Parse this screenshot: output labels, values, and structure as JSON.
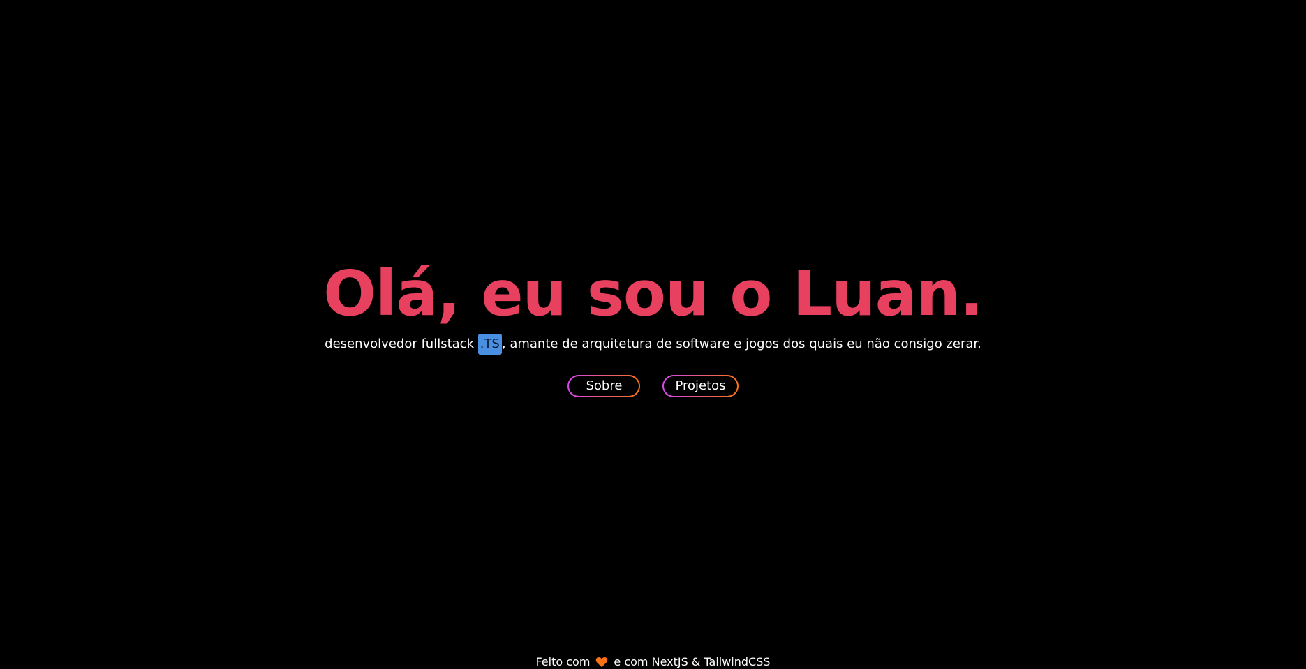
{
  "hero": {
    "title": "Olá, eu sou o Luan.",
    "subtitle_prefix": "desenvolvedor fullstack ",
    "ts_badge": ".TS",
    "subtitle_suffix": ", amante de arquitetura de software e jogos dos quais eu não consigo zerar."
  },
  "actions": {
    "about_label": "Sobre",
    "projects_label": "Projetos"
  },
  "footer": {
    "prefix": "Feito com",
    "icon": "heart-icon",
    "suffix": "e com NextJS & TailwindCSS"
  },
  "colors": {
    "background": "#000000",
    "title": "#e8405f",
    "badge": "#4a90e2",
    "gradient_start": "#d946ef",
    "gradient_end": "#f97316",
    "heart": "#f97316"
  }
}
